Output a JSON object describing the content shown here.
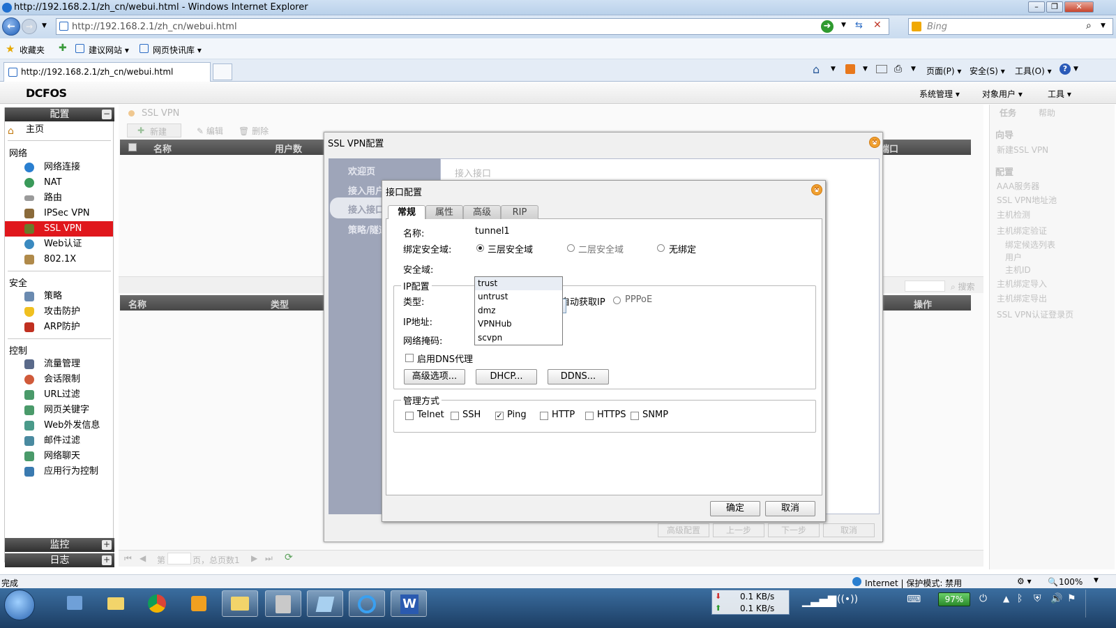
{
  "browser": {
    "window_title": "http://192.168.2.1/zh_cn/webui.html - Windows Internet Explorer",
    "address": "http://192.168.2.1/zh_cn/webui.html",
    "search_placeholder": "Bing",
    "favorites": [
      "收藏夹",
      "建议网站 ▾",
      "网页快讯库 ▾"
    ],
    "tab_title": "http://192.168.2.1/zh_cn/webui.html",
    "commands": [
      "页面(P) ▾",
      "安全(S) ▾",
      "工具(O) ▾"
    ]
  },
  "app": {
    "logo": "DCFOS",
    "top_menu": [
      "系统管理 ▾",
      "对象用户 ▾",
      "工具 ▾"
    ]
  },
  "sidebar": {
    "config_header": "配置",
    "home": "主页",
    "groups": [
      {
        "title": "网络",
        "items": [
          "网络连接",
          "NAT",
          "路由",
          "IPSec VPN",
          "SSL VPN",
          "Web认证",
          "802.1X"
        ]
      },
      {
        "title": "安全",
        "items": [
          "策略",
          "攻击防护",
          "ARP防护"
        ]
      },
      {
        "title": "控制",
        "items": [
          "流量管理",
          "会话限制",
          "URL过滤",
          "网页关键字",
          "Web外发信息",
          "邮件过滤",
          "网络聊天",
          "应用行为控制"
        ]
      }
    ],
    "selected": "SSL VPN",
    "monitor_header": "监控",
    "log_header": "日志"
  },
  "main": {
    "title": "SSL VPN",
    "toolbar": [
      "新建",
      "编辑",
      "删除"
    ],
    "grid1_cols": [
      "名称",
      "用户数",
      "端口"
    ],
    "grid2_cols": [
      "名称",
      "类型",
      "操作"
    ],
    "search": "搜索",
    "pager_page": "第",
    "pager_total": "页，总页数1"
  },
  "right_panel": {
    "tabs": [
      "任务",
      "帮助"
    ],
    "wizard_title": "向导",
    "wizard_item": "新建SSL VPN",
    "config_title": "配置",
    "items": [
      "AAA服务器",
      "SSL VPN地址池",
      "主机检测",
      "主机绑定验证"
    ],
    "sub_items": [
      "绑定候选列表",
      "用户",
      "主机ID"
    ],
    "items2": [
      "主机绑定导入",
      "主机绑定导出",
      "SSL VPN认证登录页"
    ]
  },
  "ssl_dialog": {
    "title": "SSL VPN配置",
    "steps": [
      "欢迎页",
      "接入用户",
      "接入接口",
      "策略/隧道"
    ],
    "section": "接入接口",
    "buttons": [
      "高级配置",
      "上一步",
      "下一步",
      "取消"
    ]
  },
  "iface_dialog": {
    "title": "接口配置",
    "tabs": [
      "常规",
      "属性",
      "高级",
      "RIP"
    ],
    "name_label": "名称:",
    "name_value": "tunnel1",
    "bind_label": "绑定安全域:",
    "bind_options": [
      "三层安全域",
      "二层安全域",
      "无绑定"
    ],
    "zone_label": "安全域:",
    "zone_value": "trust",
    "zone_options": [
      "trust",
      "untrust",
      "dmz",
      "VPNHub",
      "scvpn"
    ],
    "ip_legend": "IP配置",
    "type_label": "类型:",
    "type_options": [
      "自动获取IP",
      "PPPoE"
    ],
    "ip_label": "IP地址:",
    "mask_label": "网络掩码:",
    "dns_label": "启用DNS代理",
    "ip_buttons": [
      "高级选项...",
      "DHCP...",
      "DDNS..."
    ],
    "mgmt_legend": "管理方式",
    "mgmt_options": [
      "Telnet",
      "SSH",
      "Ping",
      "HTTP",
      "HTTPS",
      "SNMP"
    ],
    "ok": "确定",
    "cancel": "取消"
  },
  "statusbar": {
    "left": "完成",
    "zone": "Internet | 保护模式: 禁用",
    "zoom": "100%"
  },
  "taskbar": {
    "net_down": "0.1 KB/s",
    "net_up": "0.1 KB/s",
    "battery": "97%"
  },
  "colors": {
    "selected_nav": "#e0171c",
    "ssl_side": "#9ea5b9"
  }
}
